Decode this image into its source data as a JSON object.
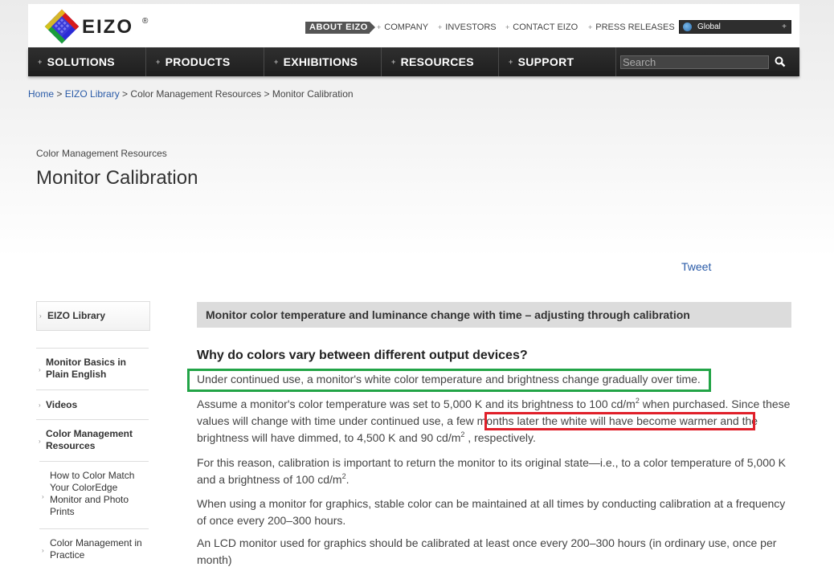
{
  "brand": {
    "name": "EIZO",
    "reg": "®"
  },
  "topnav": {
    "about": "ABOUT EIZO",
    "links": [
      "COMPANY",
      "INVESTORS",
      "CONTACT EIZO",
      "PRESS RELEASES"
    ],
    "region": "Global"
  },
  "mainnav": {
    "items": [
      "SOLUTIONS",
      "PRODUCTS",
      "EXHIBITIONS",
      "RESOURCES",
      "SUPPORT"
    ],
    "search_placeholder": "Search"
  },
  "breadcrumb": {
    "home": "Home",
    "library": "EIZO Library",
    "section": "Color Management Resources",
    "current": "Monitor Calibration",
    "sep": " > "
  },
  "page": {
    "section_label": "Color Management Resources",
    "title": "Monitor Calibration",
    "tweet": "Tweet"
  },
  "sidebar": {
    "head": "EIZO Library",
    "items": [
      "Monitor Basics in Plain English",
      "Videos",
      "Color Management Resources"
    ],
    "subitems": [
      "How to Color Match Your ColorEdge Monitor and Photo Prints",
      "Color Management in Practice"
    ]
  },
  "content": {
    "bar_title": "Monitor color temperature and luminance change with time – adjusting through calibration",
    "heading": "Why do colors vary between different output devices?",
    "p1": "Under continued use, a monitor's white color temperature and brightness change gradually over time.",
    "p2": {
      "a": "Assume a monitor's color temperature was set to 5,000 K and its brightness to 100 cd/m",
      "b": " when purchased. Since these values will change with time under continued use, a ",
      "highlight": "few months later the white will have become warmer",
      "c": " and the brightness will have dimmed, to 4,500 K and 90 cd/m",
      "d": " , respectively.",
      "sup": "2"
    },
    "p3": {
      "a": "For this reason, calibration is important to return the monitor to its   original state—i.e., to a color temperature of 5,000 K and a brightness of 100 cd/m",
      "b": ".",
      "sup": "2"
    },
    "p4": "When using a monitor for graphics, stable color can be maintained at all times by conducting calibration at a frequency of once every 200–300 hours.",
    "p5": "An LCD monitor used for graphics should be calibrated at least once every 200–300 hours (in ordinary use, once per month)"
  },
  "colors": {
    "link": "#2a5ba8",
    "green_box": "#22a447",
    "red_box": "#e0202a",
    "nav_bg": "#262626"
  }
}
